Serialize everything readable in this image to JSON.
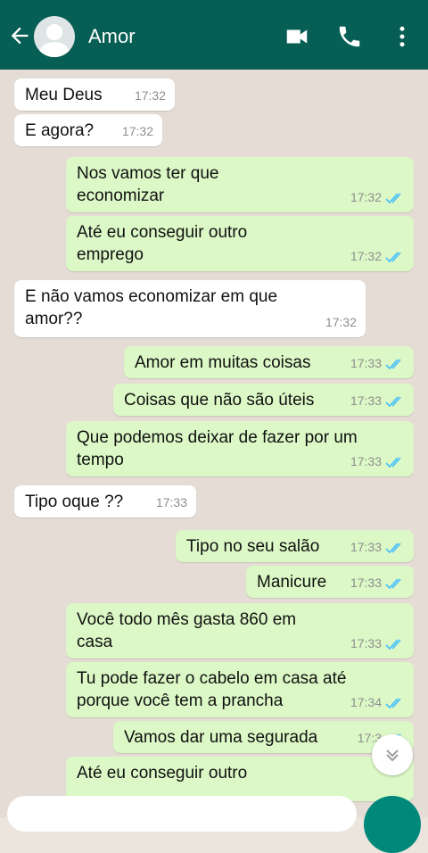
{
  "header": {
    "contact_name": "Amor",
    "back_icon": "arrow-left-icon",
    "video_icon": "video-call-icon",
    "call_icon": "phone-icon",
    "menu_icon": "more-vert-icon"
  },
  "messages": [
    {
      "dir": "in",
      "text": "Meu Deus",
      "time": "17:32"
    },
    {
      "dir": "in",
      "text": "E agora?",
      "time": "17:32"
    },
    {
      "dir": "out",
      "text": "Nos vamos ter que\neconomizar",
      "time": "17:32",
      "read": true
    },
    {
      "dir": "out",
      "text": "Até eu conseguir outro\nemprego",
      "time": "17:32",
      "read": true
    },
    {
      "dir": "in",
      "text": "E não vamos economizar em que\namor??",
      "time": "17:32"
    },
    {
      "dir": "out",
      "text": "Amor em muitas coisas",
      "time": "17:33",
      "read": true
    },
    {
      "dir": "out",
      "text": "Coisas que não são úteis",
      "time": "17:33",
      "read": true
    },
    {
      "dir": "out",
      "text": "Que podemos deixar de fazer por um\ntempo",
      "time": "17:33",
      "read": true
    },
    {
      "dir": "in",
      "text": "Tipo oque ??",
      "time": "17:33"
    },
    {
      "dir": "out",
      "text": "Tipo no seu salão",
      "time": "17:33",
      "read": true
    },
    {
      "dir": "out",
      "text": "Manicure",
      "time": "17:33",
      "read": true
    },
    {
      "dir": "out",
      "text": "Você todo mês gasta 860 em\ncasa",
      "time": "17:33",
      "read": true
    },
    {
      "dir": "out",
      "text": "Tu pode fazer o cabelo em casa até\nporque você tem a prancha",
      "time": "17:34",
      "read": true
    },
    {
      "dir": "out",
      "text": "Vamos dar uma segurada",
      "time": "17:3",
      "read": true
    },
    {
      "dir": "out",
      "text": "Até eu conseguir outro",
      "time": "",
      "read": false
    }
  ],
  "colors": {
    "header": "#075e54",
    "outgoing": "#dcf8c6",
    "incoming": "#ffffff",
    "tick_read": "#4fc3f7"
  }
}
